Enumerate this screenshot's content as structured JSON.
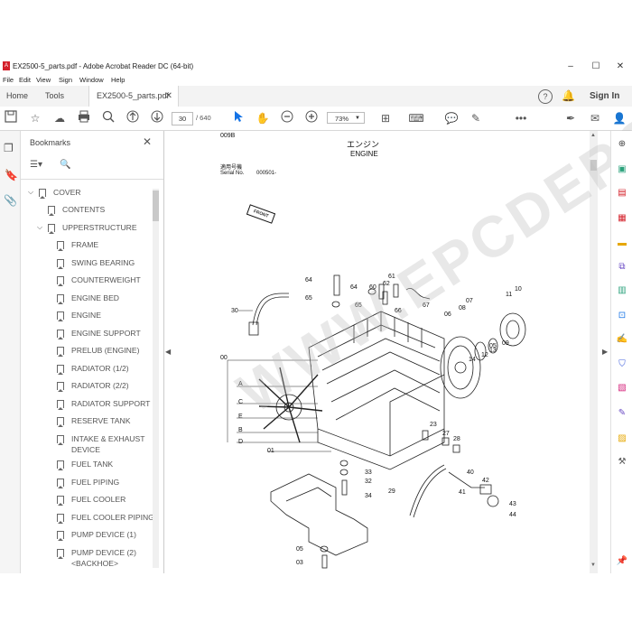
{
  "window": {
    "title": "EX2500-5_parts.pdf - Adobe Acrobat Reader DC (64-bit)",
    "controls": {
      "minimize": "–",
      "maximize": "☐",
      "close": "✕"
    }
  },
  "menu": [
    "File",
    "Edit",
    "View",
    "Sign",
    "Window",
    "Help"
  ],
  "tabs": {
    "home": "Home",
    "tools": "Tools",
    "file": "EX2500-5_parts.pdf"
  },
  "signin": "Sign In",
  "toolbar": {
    "page_current": "30",
    "page_total": "/ 640",
    "zoom": "73%"
  },
  "bookmarks": {
    "title": "Bookmarks",
    "items": [
      "COVER",
      "CONTENTS",
      "UPPERSTRUCTURE",
      "FRAME",
      "SWING BEARING",
      "COUNTERWEIGHT",
      "ENGINE  BED",
      "ENGINE",
      "ENGINE SUPPORT",
      "PRELUB (ENGINE)",
      "RADIATOR (1/2)",
      "RADIATOR (2/2)",
      "RADIATOR SUPPORT",
      "RESERVE TANK",
      "INTAKE & EXHAUST",
      "DEVICE",
      "FUEL TANK",
      "FUEL PIPING",
      "FUEL COOLER",
      "FUEL COOLER PIPING",
      "PUMP DEVICE (1)",
      "PUMP DEVICE (2)",
      "<BACKHOE>"
    ]
  },
  "document": {
    "page_code": "009B",
    "title_jp": "エンジン",
    "title_en": "ENGINE",
    "serial_jp": "適用号機",
    "serial_en": "Serial No.",
    "serial_value": "000501-",
    "front": "FRONT",
    "watermark": "WWW.EPCDEPO.COM",
    "callouts": [
      "64",
      "65",
      "61",
      "62",
      "60",
      "64",
      "65",
      "66",
      "67",
      "30",
      "07",
      "08",
      "06",
      "11",
      "10",
      "05",
      "13",
      "12",
      "14",
      "09",
      "00",
      "A",
      "C",
      "E",
      "B",
      "D",
      "01",
      "23",
      "27",
      "28",
      "33",
      "32",
      "34",
      "40",
      "42",
      "29",
      "43",
      "41",
      "44",
      "05",
      "03"
    ]
  },
  "colors": {
    "accent": "#1473e6",
    "pdf_red": "#d4202a"
  }
}
